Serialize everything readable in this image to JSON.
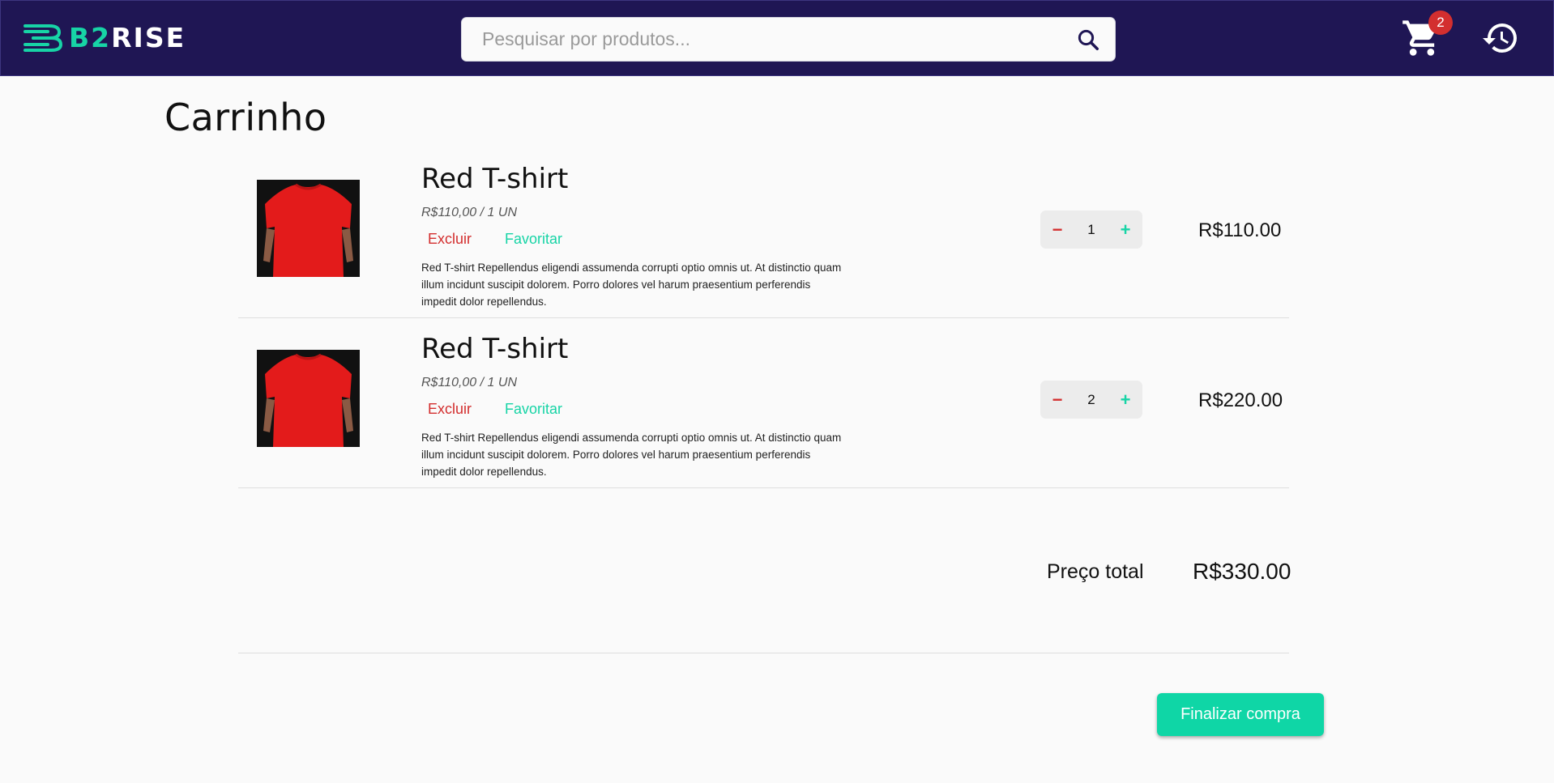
{
  "colors": {
    "header_bg": "#1f1654",
    "accent": "#17d4a6",
    "danger": "#d32f2f",
    "page_bg": "#fafafa"
  },
  "header": {
    "logo": {
      "prefix": "B2",
      "suffix": "RISE"
    },
    "search": {
      "placeholder": "Pesquisar por produtos...",
      "value": "",
      "icon": "search-icon"
    },
    "cart": {
      "icon": "cart-icon",
      "badge": "2"
    },
    "history": {
      "icon": "history-icon"
    }
  },
  "page": {
    "title": "Carrinho"
  },
  "items": [
    {
      "image": "red-tshirt-photo",
      "name": "Red T-shirt",
      "unit_price": "R$110,00 / 1 UN",
      "remove_label": "Excluir",
      "favorite_label": "Favoritar",
      "description": "Red T-shirt Repellendus eligendi assumenda corrupti optio omnis ut. At distinctio quam illum incidunt suscipit dolorem. Porro dolores vel harum praesentium perferendis impedit dolor repellendus.",
      "minus": "−",
      "quantity": "1",
      "plus": "+",
      "line_total": "R$110.00"
    },
    {
      "image": "red-tshirt-photo",
      "name": "Red T-shirt",
      "unit_price": "R$110,00 / 1 UN",
      "remove_label": "Excluir",
      "favorite_label": "Favoritar",
      "description": "Red T-shirt Repellendus eligendi assumenda corrupti optio omnis ut. At distinctio quam illum incidunt suscipit dolorem. Porro dolores vel harum praesentium perferendis impedit dolor repellendus.",
      "minus": "−",
      "quantity": "2",
      "plus": "+",
      "line_total": "R$220.00"
    }
  ],
  "summary": {
    "total_label": "Preço total",
    "total_value": "R$330.00",
    "checkout_label": "Finalizar compra"
  }
}
